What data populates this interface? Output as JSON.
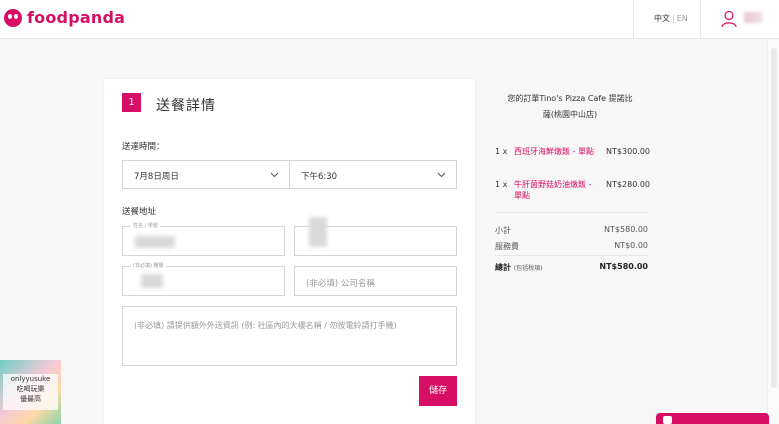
{
  "header": {
    "brand": "foodpanda",
    "lang_active": "中文",
    "lang_sep": "|",
    "lang_other": "EN"
  },
  "form": {
    "step_number": "1",
    "step_title": "送餐詳情",
    "delivery_time_label": "送達時間：",
    "date_value": "7月8日周日",
    "time_value": "下午6:30",
    "address_label": "送餐地址",
    "name_field_label": "姓名 / 學號",
    "phone_field_label": "(非必填) 樓層",
    "company_placeholder": "(非必填) 公司名稱",
    "notes_placeholder": "(非必填) 請提供額外外送資訊 (例: 社區內的大樓名稱 / 勿按電鈴請打手機)",
    "save_label": "儲存"
  },
  "summary": {
    "title_line1": "您的訂單Tino's Pizza Cafe 提諾比",
    "title_line2": "薩(桃園中山店)",
    "items": [
      {
        "qty": "1 x",
        "name": "西班牙海鮮燉飯 - 單點",
        "price": "NT$300.00"
      },
      {
        "qty": "1 x",
        "name": "牛肝菌野菇奶油燉飯 - 單點",
        "price": "NT$280.00"
      }
    ],
    "subtotal_label": "小計",
    "subtotal_value": "NT$580.00",
    "service_label": "服務費",
    "service_value": "NT$0.00",
    "total_label": "總計",
    "total_note": "(包括稅項)",
    "total_value": "NT$580.00"
  },
  "watermark": {
    "line1": "onlyyusuke",
    "line2": "吃喝玩樂",
    "line3": "優最高"
  },
  "colors": {
    "brand": "#d70f64"
  }
}
